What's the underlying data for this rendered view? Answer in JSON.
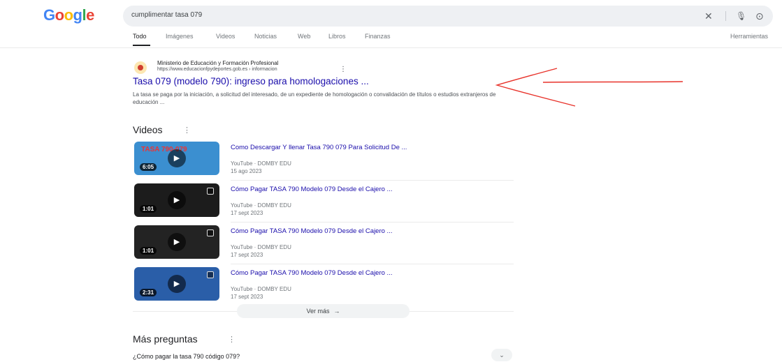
{
  "logo": {
    "letters": [
      {
        "ch": "G",
        "color": "#4285f4"
      },
      {
        "ch": "o",
        "color": "#ea4335"
      },
      {
        "ch": "o",
        "color": "#fbbc05"
      },
      {
        "ch": "g",
        "color": "#4285f4"
      },
      {
        "ch": "l",
        "color": "#34a853"
      },
      {
        "ch": "e",
        "color": "#ea4335"
      }
    ]
  },
  "search": {
    "query": "cumplimentar tasa 079",
    "clear_icon": "✕",
    "mic_icon": "🎙",
    "lens_icon": "⊙"
  },
  "tabs": [
    {
      "label": "Todo",
      "active": true
    },
    {
      "label": "Imágenes",
      "active": false
    },
    {
      "label": "Videos",
      "active": false
    },
    {
      "label": "Noticias",
      "active": false
    },
    {
      "label": "Web",
      "active": false
    },
    {
      "label": "Libros",
      "active": false
    },
    {
      "label": "Finanzas",
      "active": false
    }
  ],
  "tools_label": "Herramientas",
  "result": {
    "site_name": "Ministerio de Educación y Formación Profesional",
    "url": "https://www.educacionfpydeportes.gob.es › informacion",
    "menu": "⋮",
    "title": "Tasa 079 (modelo 790): ingreso para homologaciones ...",
    "snippet": "La tasa se paga por la iniciación, a solicitud del interesado, de un expediente de homologación o convalidación de títulos o estudios extranjeros de educación ..."
  },
  "videos_section": {
    "title": "Videos",
    "menu": "⋮",
    "items": [
      {
        "title": "Como Descargar Y llenar Tasa 790 079 Para Solicitud De ...",
        "source": "YouTube · DOMBY EDU",
        "date": "15 ago 2023",
        "duration": "6:05",
        "thumb_color": "#3b8fd0",
        "thumb_text": "TASA 790-079"
      },
      {
        "title": "Cómo Pagar TASA 790 Modelo 079 Desde el Cajero ...",
        "source": "YouTube · DOMBY EDU",
        "date": "17 sept 2023",
        "duration": "1:01",
        "thumb_color": "#1c1c1c",
        "thumb_text": ""
      },
      {
        "title": "Cómo Pagar TASA 790 Modelo 079 Desde el Cajero ...",
        "source": "YouTube · DOMBY EDU",
        "date": "17 sept 2023",
        "duration": "1:01",
        "thumb_color": "#232323",
        "thumb_text": ""
      },
      {
        "title": "Cómo Pagar TASA 790 Modelo 079 Desde el Cajero ...",
        "source": "YouTube · DOMBY EDU",
        "date": "17 sept 2023",
        "duration": "2:31",
        "thumb_color": "#2a5ea8",
        "thumb_text": ""
      }
    ],
    "more_label": "Ver más",
    "more_arrow": "→"
  },
  "paa": {
    "title": "Más preguntas",
    "menu": "⋮",
    "questions": [
      "¿Cómo pagar la tasa 790 código 079?"
    ],
    "chevron": "⌄"
  },
  "annotation_color": "#e8322a"
}
